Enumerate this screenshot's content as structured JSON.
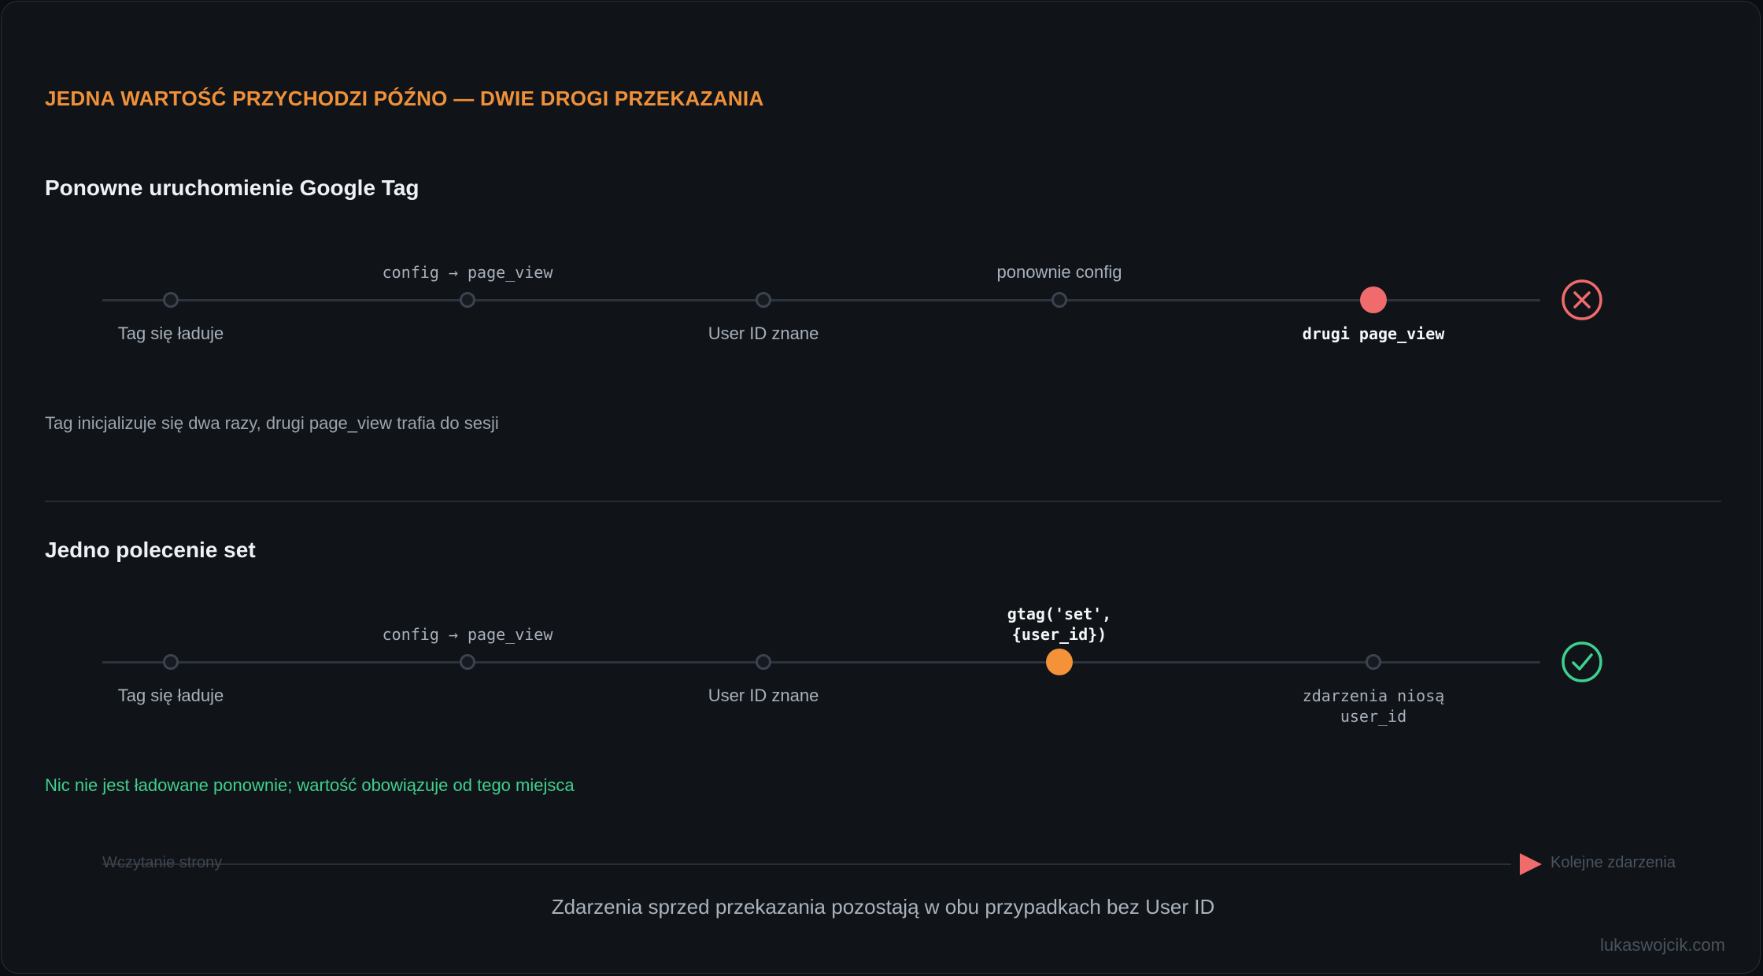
{
  "title": "JEDNA WARTOŚĆ PRZYCHODZI PÓŹNO — DWIE DROGI PRZEKAZANIA",
  "colors": {
    "accent": "#f0913a",
    "error": "#f06b6b",
    "success": "#3fcf8e",
    "highlight_node": "#f4923a"
  },
  "sections": [
    {
      "title": "Ponowne uruchomienie Google Tag",
      "status_icon": "x-circle-icon",
      "labels_above": {
        "step2": "config → page_view",
        "step4": "ponownie config"
      },
      "labels_below": {
        "step1": "Tag się ładuje",
        "step3": "User ID znane",
        "step5": "drugi page_view"
      },
      "note": "Tag inicjalizuje się dwa razy, drugi page_view trafia do sesji"
    },
    {
      "title": "Jedno polecenie set",
      "status_icon": "check-circle-icon",
      "labels_above": {
        "step2": "config → page_view",
        "step4_line1": "gtag('set',",
        "step4_line2": "{user_id})"
      },
      "labels_below": {
        "step1": "Tag się ładuje",
        "step3": "User ID znane",
        "step5_line1": "zdarzenia niosą",
        "step5_line2": "user_id"
      },
      "note": "Nic nie jest ładowane ponownie; wartość obowiązuje od tego miejsca"
    }
  ],
  "flow": {
    "start": "Wczytanie strony",
    "end": "Kolejne zdarzenia"
  },
  "caption": "Zdarzenia sprzed przekazania pozostają w obu przypadkach bez User ID",
  "watermark": "lukaswojcik.com"
}
